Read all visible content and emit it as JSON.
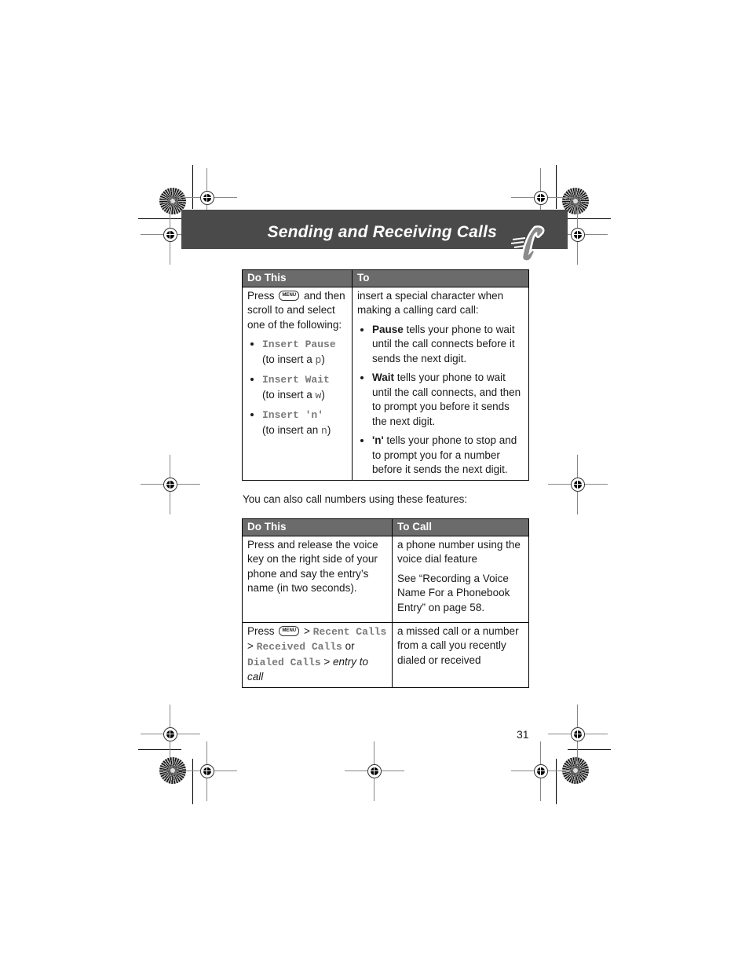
{
  "header": {
    "title": "Sending and Receiving Calls",
    "icon": "phone-handset-icon"
  },
  "table1": {
    "headers": [
      "Do This",
      "To"
    ],
    "row": {
      "do_intro_before": "Press",
      "menu_key": "MENU",
      "do_intro_after": "and then scroll to and select one of the following:",
      "options": [
        {
          "name": "Insert Pause",
          "note_prefix": "(to insert a ",
          "char": "p",
          "note_suffix": ")"
        },
        {
          "name": "Insert Wait",
          "note_prefix": "(to insert a ",
          "char": "w",
          "note_suffix": ")"
        },
        {
          "name": "Insert 'n'",
          "note_prefix": "(to insert an ",
          "char": "n",
          "note_suffix": ")"
        }
      ],
      "to_intro": "insert a special character when making a calling card call:",
      "to_items": [
        {
          "term": "Pause",
          "text": " tells your phone to wait until the call connects before it sends the next digit."
        },
        {
          "term": "Wait",
          "text": " tells your phone to wait until the call connects, and then to prompt you before it sends the next digit."
        },
        {
          "term": "'n'",
          "text": " tells your phone to stop and to prompt you for a number before it sends the next digit."
        }
      ]
    }
  },
  "intro_text": "You can also call numbers using these features:",
  "table2": {
    "headers": [
      "Do This",
      "To Call"
    ],
    "rows": [
      {
        "do": "Press and release the voice key on the right side of your phone and say the entry’s name (in two seconds).",
        "to": "a phone number using the voice dial feature",
        "to_see": "See “Recording a Voice Name For a Phonebook Entry” on page 58."
      },
      {
        "do_press": "Press",
        "menu_key": "MENU",
        "sep": " > ",
        "recent": "Recent Calls",
        "received": "Received Calls",
        "or": " or",
        "dialed": "Dialed Calls",
        "entry": "entry to call",
        "to": "a missed call or a number from a call you recently dialed or received"
      }
    ]
  },
  "page_number": "31"
}
